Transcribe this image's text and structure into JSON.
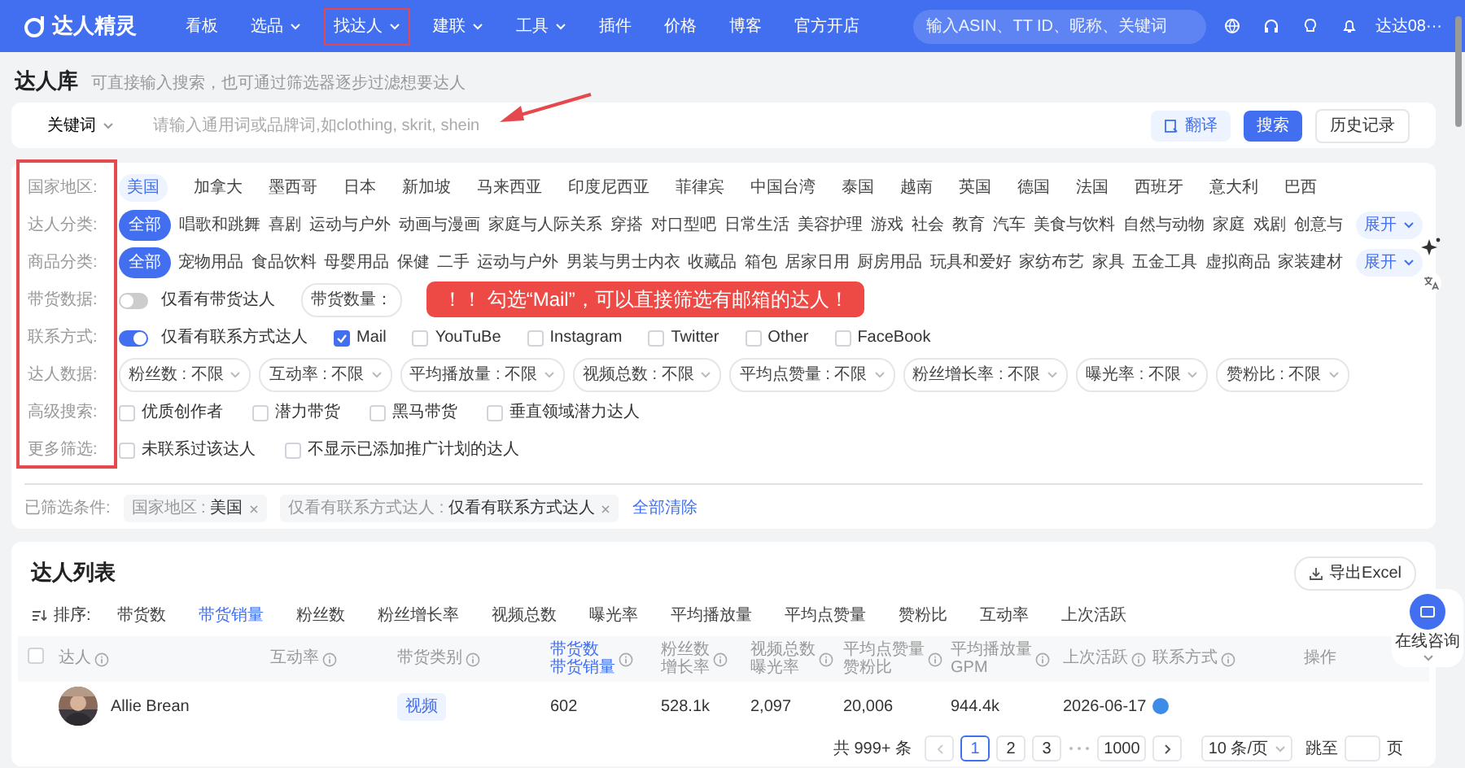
{
  "nav": {
    "brand": "达人精灵",
    "items": [
      {
        "label": "看板",
        "dropdown": false,
        "boxed": false
      },
      {
        "label": "选品",
        "dropdown": true,
        "boxed": false
      },
      {
        "label": "找达人",
        "dropdown": true,
        "boxed": true
      },
      {
        "label": "建联",
        "dropdown": true,
        "boxed": false
      },
      {
        "label": "工具",
        "dropdown": true,
        "boxed": false
      },
      {
        "label": "插件",
        "dropdown": false,
        "boxed": false
      },
      {
        "label": "价格",
        "dropdown": false,
        "boxed": false
      },
      {
        "label": "博客",
        "dropdown": false,
        "boxed": false
      },
      {
        "label": "官方开店",
        "dropdown": false,
        "boxed": false
      }
    ],
    "search_placeholder": "输入ASIN、TT ID、昵称、关键词",
    "user": "达达08···"
  },
  "page": {
    "title": "达人库",
    "hint": "可直接输入搜索，也可通过筛选器逐步过滤想要达人"
  },
  "search": {
    "mode": "关键词",
    "placeholder": "请输入通用词或品牌词,如clothing, skrit, shein",
    "translate": "翻译",
    "submit": "搜索",
    "history": "历史记录"
  },
  "filters": [
    {
      "label": "国家地区:",
      "kind": "tags",
      "items": [
        {
          "label": "美国",
          "selected": true
        },
        {
          "label": "加拿大",
          "selected": false
        },
        {
          "label": "墨西哥",
          "selected": false
        },
        {
          "label": "日本",
          "selected": false
        },
        {
          "label": "新加坡",
          "selected": false
        },
        {
          "label": "马来西亚",
          "selected": false
        },
        {
          "label": "印度尼西亚",
          "selected": false
        },
        {
          "label": "菲律宾",
          "selected": false
        },
        {
          "label": "中国台湾",
          "selected": false
        },
        {
          "label": "泰国",
          "selected": false
        },
        {
          "label": "越南",
          "selected": false
        },
        {
          "label": "英国",
          "selected": false
        },
        {
          "label": "德国",
          "selected": false
        },
        {
          "label": "法国",
          "selected": false
        },
        {
          "label": "西班牙",
          "selected": false
        },
        {
          "label": "意大利",
          "selected": false
        },
        {
          "label": "巴西",
          "selected": false
        }
      ]
    },
    {
      "label": "达人分类:",
      "kind": "pills",
      "expand": "展开",
      "items": [
        {
          "label": "全部",
          "selected": true
        },
        {
          "label": "唱歌和跳舞",
          "selected": false
        },
        {
          "label": "喜剧",
          "selected": false
        },
        {
          "label": "运动与户外",
          "selected": false
        },
        {
          "label": "动画与漫画",
          "selected": false
        },
        {
          "label": "家庭与人际关系",
          "selected": false
        },
        {
          "label": "穿搭",
          "selected": false
        },
        {
          "label": "对口型吧",
          "selected": false
        },
        {
          "label": "日常生活",
          "selected": false
        },
        {
          "label": "美容护理",
          "selected": false
        },
        {
          "label": "游戏",
          "selected": false
        },
        {
          "label": "社会",
          "selected": false
        },
        {
          "label": "教育",
          "selected": false
        },
        {
          "label": "汽车",
          "selected": false
        },
        {
          "label": "美食与饮料",
          "selected": false
        },
        {
          "label": "自然与动物",
          "selected": false
        },
        {
          "label": "家庭",
          "selected": false
        },
        {
          "label": "戏剧",
          "selected": false
        },
        {
          "label": "创意与",
          "selected": false
        }
      ]
    },
    {
      "label": "商品分类:",
      "kind": "pills",
      "expand": "展开",
      "items": [
        {
          "label": "全部",
          "selected": true
        },
        {
          "label": "宠物用品",
          "selected": false
        },
        {
          "label": "食品饮料",
          "selected": false
        },
        {
          "label": "母婴用品",
          "selected": false
        },
        {
          "label": "保健",
          "selected": false
        },
        {
          "label": "二手",
          "selected": false
        },
        {
          "label": "运动与户外",
          "selected": false
        },
        {
          "label": "男装与男士内衣",
          "selected": false
        },
        {
          "label": "收藏品",
          "selected": false
        },
        {
          "label": "箱包",
          "selected": false
        },
        {
          "label": "居家日用",
          "selected": false
        },
        {
          "label": "厨房用品",
          "selected": false
        },
        {
          "label": "玩具和爱好",
          "selected": false
        },
        {
          "label": "家纺布艺",
          "selected": false
        },
        {
          "label": "家具",
          "selected": false
        },
        {
          "label": "五金工具",
          "selected": false
        },
        {
          "label": "虚拟商品",
          "selected": false
        },
        {
          "label": "家装建材",
          "selected": false
        }
      ]
    },
    {
      "label": "带货数据:",
      "kind": "switch",
      "switch": {
        "label": "仅看有带货达人",
        "on": false
      },
      "items": [
        {
          "label": "带货数量："
        }
      ]
    },
    {
      "label": "联系方式:",
      "kind": "switch-checks",
      "switch": {
        "label": "仅看有联系方式达人",
        "on": true
      },
      "items": [
        {
          "label": "Mail",
          "checked": true
        },
        {
          "label": "YouTuBe",
          "checked": false
        },
        {
          "label": "Instagram",
          "checked": false
        },
        {
          "label": "Twitter",
          "checked": false
        },
        {
          "label": "Other",
          "checked": false
        },
        {
          "label": "FaceBook",
          "checked": false
        }
      ]
    },
    {
      "label": "达人数据:",
      "kind": "dropdowns",
      "items": [
        {
          "label": "粉丝数 : 不限"
        },
        {
          "label": "互动率 : 不限"
        },
        {
          "label": "平均播放量 : 不限"
        },
        {
          "label": "视频总数 : 不限"
        },
        {
          "label": "平均点赞量 : 不限"
        },
        {
          "label": "粉丝增长率 : 不限"
        },
        {
          "label": "曝光率 : 不限"
        },
        {
          "label": "赞粉比 : 不限"
        }
      ]
    },
    {
      "label": "高级搜索:",
      "kind": "checks",
      "items": [
        {
          "label": "优质创作者",
          "checked": false
        },
        {
          "label": "潜力带货",
          "checked": false
        },
        {
          "label": "黑马带货",
          "checked": false
        },
        {
          "label": "垂直领域潜力达人",
          "checked": false
        }
      ]
    },
    {
      "label": "更多筛选:",
      "kind": "checks",
      "items": [
        {
          "label": "未联系过该达人",
          "checked": false
        },
        {
          "label": "不显示已添加推广计划的达人",
          "checked": false
        }
      ]
    }
  ],
  "callout": "！！ 勾选“Mail”，可以直接筛选有邮箱的达人！",
  "applied": {
    "label": "已筛选条件:",
    "tags": [
      {
        "key": "国家地区 : ",
        "value": "美国"
      },
      {
        "key": "仅看有联系方式达人 : ",
        "value": "仅看有联系方式达人"
      }
    ],
    "clear": "全部清除"
  },
  "list": {
    "title": "达人列表",
    "export": "导出Excel",
    "sort_label": "排序:",
    "sort": [
      {
        "label": "带货数",
        "selected": false
      },
      {
        "label": "带货销量",
        "selected": true
      },
      {
        "label": "粉丝数",
        "selected": false
      },
      {
        "label": "粉丝增长率",
        "selected": false
      },
      {
        "label": "视频总数",
        "selected": false
      },
      {
        "label": "曝光率",
        "selected": false
      },
      {
        "label": "平均播放量",
        "selected": false
      },
      {
        "label": "平均点赞量",
        "selected": false
      },
      {
        "label": "赞粉比",
        "selected": false
      },
      {
        "label": "互动率",
        "selected": false
      },
      {
        "label": "上次活跃",
        "selected": false
      }
    ],
    "select_all": {
      "checked": false
    },
    "columns": [
      {
        "lines": [
          "达人"
        ],
        "kind": "creator",
        "info": true,
        "active": false
      },
      {
        "lines": [
          "互动率"
        ],
        "kind": "text",
        "info": true,
        "active": false
      },
      {
        "lines": [
          "带货类别"
        ],
        "kind": "tag",
        "info": true,
        "active": false
      },
      {
        "lines": [
          "带货数",
          "带货销量"
        ],
        "kind": "text",
        "info": true,
        "active": true
      },
      {
        "lines": [
          "粉丝数",
          "增长率"
        ],
        "kind": "text",
        "info": true,
        "active": false
      },
      {
        "lines": [
          "视频总数",
          "曝光率"
        ],
        "kind": "text",
        "info": true,
        "active": false
      },
      {
        "lines": [
          "平均点赞量",
          "赞粉比"
        ],
        "kind": "text",
        "info": true,
        "active": false
      },
      {
        "lines": [
          "平均播放量",
          "GPM"
        ],
        "kind": "text",
        "info": true,
        "active": false
      },
      {
        "lines": [
          "上次活跃"
        ],
        "kind": "text",
        "info": true,
        "active": false
      },
      {
        "lines": [
          "联系方式"
        ],
        "kind": "contact",
        "info": true,
        "active": false
      },
      {
        "lines": [
          "操作"
        ],
        "kind": "actions",
        "info": false,
        "active": false
      }
    ],
    "rows": [
      {
        "cells": [
          "Allie Brean",
          "",
          "视频",
          "602",
          "528.1k",
          "2,097",
          "20,006",
          "944.4k",
          "2026-06-17"
        ]
      }
    ],
    "pagination": {
      "total": "共 999+ 条",
      "pages": [
        {
          "label": "1",
          "selected": true
        },
        {
          "label": "2",
          "selected": false
        },
        {
          "label": "3",
          "selected": false
        }
      ],
      "last": "1000",
      "page_size": "10 条/页",
      "jump": "跳至",
      "unit": "页"
    }
  },
  "chat": {
    "label": "在线咨询"
  }
}
